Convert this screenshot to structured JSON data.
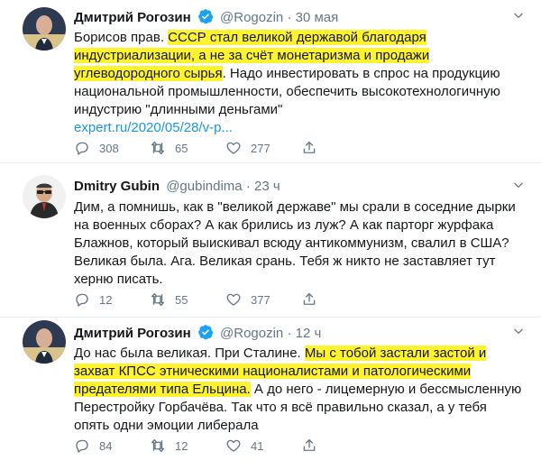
{
  "tweets": [
    {
      "name": "Дмитрий Рогозин",
      "handle": "@Rogozin",
      "separator": "·",
      "time": "30 мая",
      "text_plain_1": "Борисов прав. ",
      "text_hl_1": "СССР стал великой державой благодаря индустриализации, а не за счёт монетаризма и продажи углеводородного сырья",
      "text_plain_2": ". Надо инвестировать в спрос на продукцию национальной промышленности, обеспечить высокотехнологичную индустрию \"длинными деньгами\"",
      "link": "expert.ru/2020/05/28/v-p...",
      "replies": "308",
      "retweets": "65",
      "likes": "277"
    },
    {
      "name": "Dmitry Gubin",
      "handle": "@gubindima",
      "separator": "·",
      "time": "23 ч",
      "text": "Дим, а помнишь, как в \"великой державе\" мы срали в соседние дырки на военных сборах? А как брились из луж? А как парторг журфака Блажнов, который выискивал всюду антикоммунизм, свалил в США? Великая была. Ага. Великая срань. Тебя ж никто не заставляет тут херню писать.",
      "replies": "12",
      "retweets": "55",
      "likes": "377"
    },
    {
      "name": "Дмитрий Рогозин",
      "handle": "@Rogozin",
      "separator": "·",
      "time": "12 ч",
      "text_plain_1": "До нас была великая. При Сталине. ",
      "text_hl_1": "Мы с тобой застали застой и захват КПСС этническими националистами и патологическими предателями типа Ельцина.",
      "text_plain_2": " А до него - лицемерную и бессмысленную Перестройку Горбачёва. Так что я всё правильно сказал, а у тебя опять одни эмоции либерала",
      "replies": "84",
      "retweets": "12",
      "likes": "41"
    }
  ],
  "icons": {
    "reply": "reply-icon",
    "retweet": "retweet-icon",
    "like": "heart-icon",
    "share": "share-icon",
    "verified": "verified-badge-icon",
    "more": "chevron-down-icon"
  },
  "colors": {
    "accent": "#1da1f2",
    "link": "#1b95e0",
    "highlight": "#fff22e",
    "muted": "#657786",
    "text": "#14171a"
  }
}
